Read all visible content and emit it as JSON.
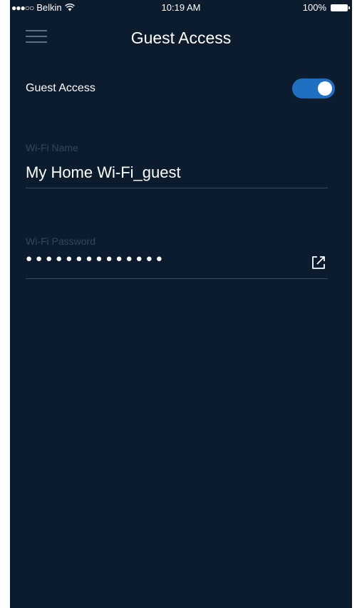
{
  "status_bar": {
    "carrier": "Belkin",
    "signal": "●●●○○",
    "time": "10:19 AM",
    "battery": "100%"
  },
  "header": {
    "title": "Guest Access"
  },
  "guest_access": {
    "label": "Guest Access",
    "enabled": true,
    "accent_color": "#1f6fc2"
  },
  "wifi_name": {
    "label": "Wi-Fi Name",
    "value": "My Home Wi-Fi_guest"
  },
  "wifi_password": {
    "label": "Wi-Fi Password",
    "masked_value": "●●●●●●●●●●●●●●"
  },
  "icons": {
    "menu": "menu-icon",
    "share": "share-icon",
    "wifi": "wifi-icon",
    "battery": "battery-icon"
  }
}
